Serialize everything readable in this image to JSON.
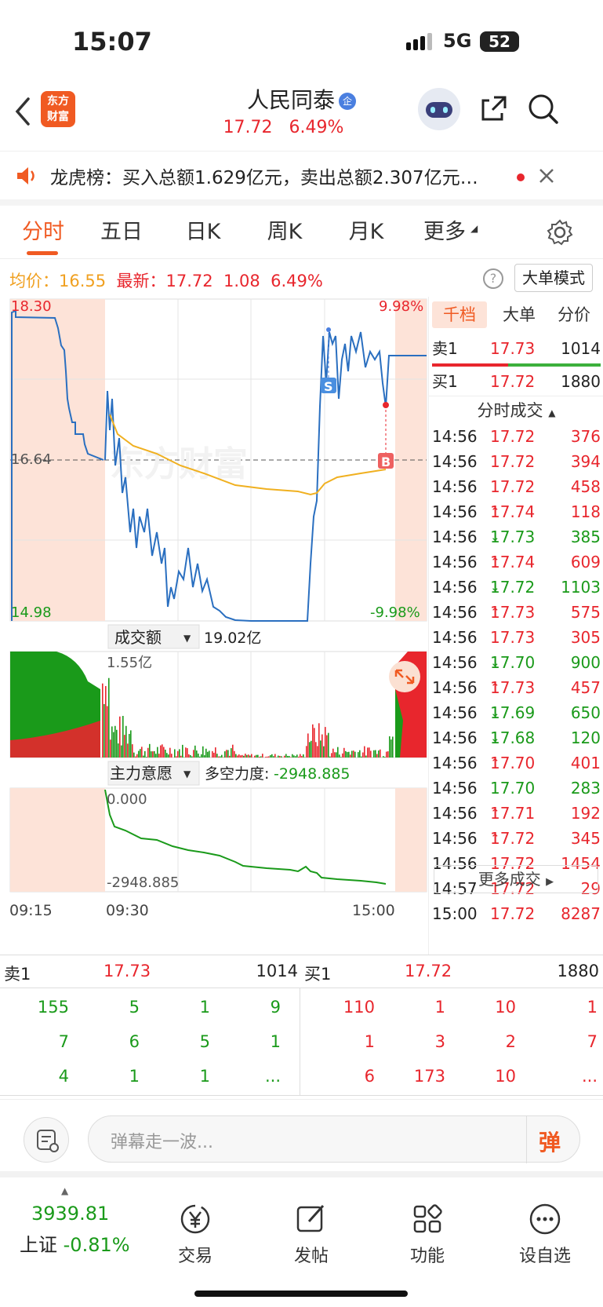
{
  "status": {
    "time": "15:07",
    "network": "5G",
    "battery": "52"
  },
  "nav": {
    "logo_line1": "东方",
    "logo_line2": "财富",
    "title": "人民同泰",
    "badge": "企",
    "price": "17.72",
    "change_pct": "6.49%"
  },
  "notice": {
    "text": "龙虎榜：买入总额1.629亿元，卖出总额2.307亿元…"
  },
  "tabs": [
    "分时",
    "五日",
    "日K",
    "周K",
    "月K",
    "更多"
  ],
  "info": {
    "avg_label": "均价：",
    "avg": "16.55",
    "last_label": "最新：",
    "last": "17.72",
    "chg": "1.08",
    "pct": "6.49%",
    "mode": "大单模式"
  },
  "price_chart": {
    "high": "18.30",
    "high_pct": "9.98%",
    "mid": "16.64",
    "low": "14.98",
    "low_pct": "-9.98%",
    "watermark": "东方财富",
    "marker_s": "S",
    "marker_b": "B"
  },
  "volume": {
    "label": "成交额",
    "total": "19.02亿",
    "max": "1.55亿"
  },
  "force": {
    "label": "主力意愿",
    "name": "多空力度:",
    "value": "-2948.885",
    "top": "0.000",
    "bottom": "-2948.885"
  },
  "time_axis": [
    "09:15",
    "09:30",
    "15:00"
  ],
  "chart_data": {
    "type": "line",
    "series": [
      {
        "name": "price",
        "x": [
          "09:30",
          "09:40",
          "09:50",
          "10:00",
          "10:15",
          "10:30",
          "10:45",
          "11:00",
          "11:15",
          "11:30",
          "13:00",
          "13:15",
          "13:30",
          "13:45",
          "14:00",
          "14:15",
          "14:30",
          "14:40",
          "14:45",
          "14:50",
          "14:56",
          "15:00"
        ],
        "values": [
          16.64,
          16.2,
          15.85,
          15.7,
          15.4,
          15.25,
          15.05,
          14.98,
          14.98,
          14.98,
          14.98,
          14.98,
          14.98,
          14.98,
          14.98,
          14.98,
          15.5,
          18.1,
          17.8,
          18.1,
          17.72,
          17.72
        ]
      },
      {
        "name": "avg",
        "x": [
          "09:30",
          "10:00",
          "10:30",
          "11:00",
          "13:00",
          "13:30",
          "14:00",
          "14:30",
          "14:45",
          "15:00"
        ],
        "values": [
          16.5,
          16.5,
          16.35,
          16.25,
          16.18,
          16.15,
          16.12,
          16.08,
          16.3,
          16.55
        ]
      }
    ],
    "ylim": [
      14.98,
      18.3
    ]
  },
  "right": {
    "tabs": [
      "千档",
      "大单",
      "分价"
    ],
    "sell1": {
      "label": "卖1",
      "price": "17.73",
      "vol": "1014"
    },
    "buy1": {
      "label": "买1",
      "price": "17.72",
      "vol": "1880"
    },
    "section": "分时成交",
    "more": "更多成交",
    "trades": [
      {
        "t": "14:56",
        "p": "17.72",
        "d": "",
        "v": "376",
        "c": "red"
      },
      {
        "t": "14:56",
        "p": "17.72",
        "d": "",
        "v": "394",
        "c": "red"
      },
      {
        "t": "14:56",
        "p": "17.72",
        "d": "",
        "v": "458",
        "c": "red"
      },
      {
        "t": "14:56",
        "p": "17.74",
        "d": "↑",
        "v": "118",
        "c": "red"
      },
      {
        "t": "14:56",
        "p": "17.73",
        "d": "↓",
        "v": "385",
        "c": "green"
      },
      {
        "t": "14:56",
        "p": "17.74",
        "d": "↑",
        "v": "609",
        "c": "red"
      },
      {
        "t": "14:56",
        "p": "17.72",
        "d": "↓",
        "v": "1103",
        "c": "green"
      },
      {
        "t": "14:56",
        "p": "17.73",
        "d": "↑",
        "v": "575",
        "c": "red"
      },
      {
        "t": "14:56",
        "p": "17.73",
        "d": "",
        "v": "305",
        "c": "red"
      },
      {
        "t": "14:56",
        "p": "17.70",
        "d": "↓",
        "v": "900",
        "c": "green"
      },
      {
        "t": "14:56",
        "p": "17.73",
        "d": "↑",
        "v": "457",
        "c": "red"
      },
      {
        "t": "14:56",
        "p": "17.69",
        "d": "↓",
        "v": "650",
        "c": "green"
      },
      {
        "t": "14:56",
        "p": "17.68",
        "d": "↓",
        "v": "120",
        "c": "green"
      },
      {
        "t": "14:56",
        "p": "17.70",
        "d": "↑",
        "v": "401",
        "c": "red"
      },
      {
        "t": "14:56",
        "p": "17.70",
        "d": "",
        "v": "283",
        "c": "green"
      },
      {
        "t": "14:56",
        "p": "17.71",
        "d": "↑",
        "v": "192",
        "c": "red"
      },
      {
        "t": "14:56",
        "p": "17.72",
        "d": "↑",
        "v": "345",
        "c": "red"
      },
      {
        "t": "14:56",
        "p": "17.72",
        "d": "",
        "v": "1454",
        "c": "red"
      },
      {
        "t": "14:57",
        "p": "17.72",
        "d": "",
        "v": "29",
        "c": "red"
      },
      {
        "t": "15:00",
        "p": "17.72",
        "d": "",
        "v": "8287",
        "c": "red"
      }
    ]
  },
  "depth": {
    "sell_label": "卖1",
    "sell_price": "17.73",
    "sell_vol": "1014",
    "buy_label": "买1",
    "buy_price": "17.72",
    "buy_vol": "1880",
    "sell_rows": [
      [
        "155",
        "5",
        "1",
        "9"
      ],
      [
        "7",
        "6",
        "5",
        "1"
      ],
      [
        "4",
        "1",
        "1",
        "..."
      ]
    ],
    "buy_rows": [
      [
        "110",
        "1",
        "10",
        "1"
      ],
      [
        "1",
        "3",
        "2",
        "7"
      ],
      [
        "6",
        "173",
        "10",
        "..."
      ]
    ]
  },
  "comment": {
    "placeholder": "弹幕走一波...",
    "danmu": "弹"
  },
  "bottom": {
    "index_value": "3939.81",
    "index_name": "上证",
    "index_pct": "-0.81%",
    "items": [
      "交易",
      "发帖",
      "功能",
      "设自选"
    ]
  },
  "colors": {
    "up": "#e8262d",
    "down": "#1a9a1a",
    "price_line": "#2a6fc0",
    "avg_line": "#f0b020",
    "accent": "#f05a22"
  }
}
